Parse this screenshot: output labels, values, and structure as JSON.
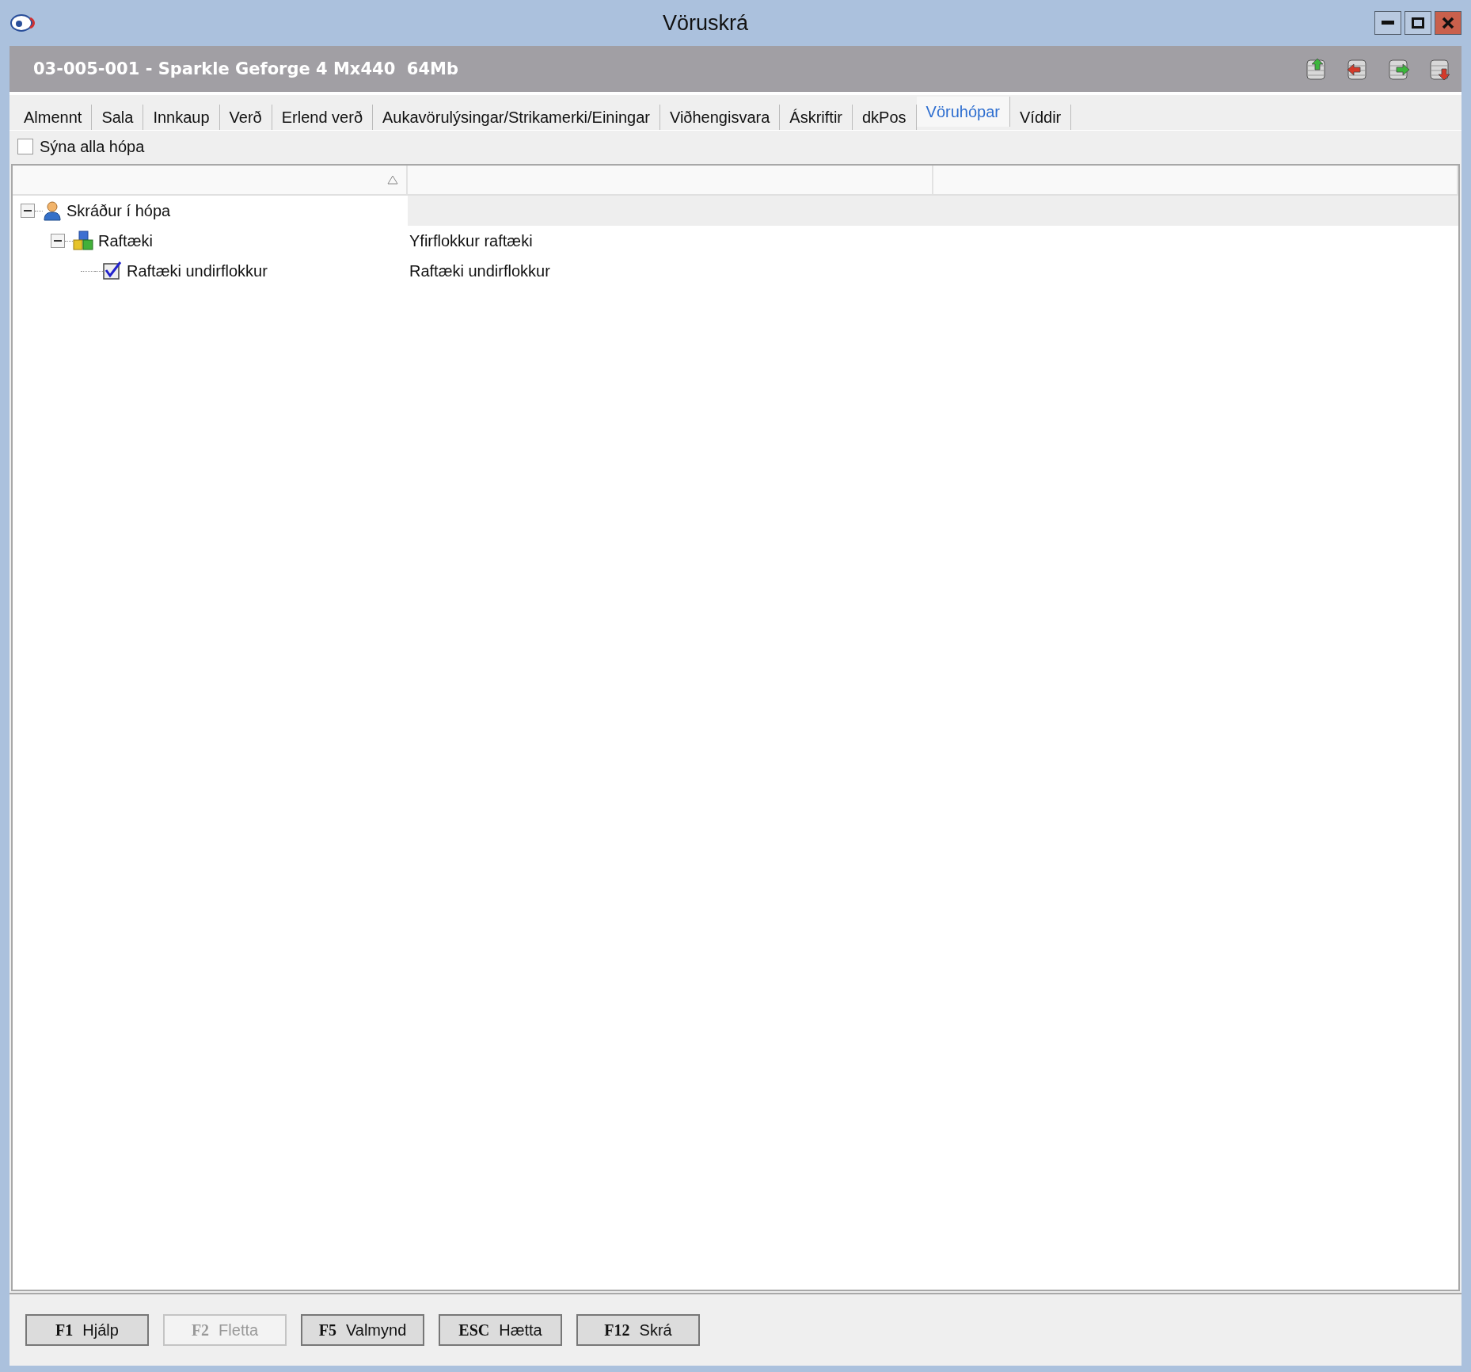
{
  "window": {
    "title": "Vöruskrá"
  },
  "header": {
    "title": "03-005-001 - Sparkle Geforge 4 Mx440  64Mb"
  },
  "tabs": [
    {
      "label": "Almennt",
      "selected": false
    },
    {
      "label": "Sala",
      "selected": false
    },
    {
      "label": "Innkaup",
      "selected": false
    },
    {
      "label": "Verð",
      "selected": false
    },
    {
      "label": "Erlend verð",
      "selected": false
    },
    {
      "label": "Aukavörulýsingar/Strikamerki/Einingar",
      "selected": false
    },
    {
      "label": "Viðhengisvara",
      "selected": false
    },
    {
      "label": "Áskriftir",
      "selected": false
    },
    {
      "label": "dkPos",
      "selected": false
    },
    {
      "label": "Vöruhópar",
      "selected": true
    },
    {
      "label": "Víddir",
      "selected": false
    }
  ],
  "show_all_groups": {
    "label": "Sýna alla hópa",
    "checked": false
  },
  "tree": {
    "rows": [
      {
        "kind": "group",
        "label": "Skráður í hópa",
        "expanded": true,
        "children": [
          {
            "kind": "category",
            "label": "Raftæki",
            "description": "Yfirflokkur raftæki",
            "expanded": true,
            "children": [
              {
                "kind": "leaf",
                "label": "Raftæki undirflokkur",
                "description": "Raftæki undirflokkur",
                "checked": true
              }
            ]
          }
        ]
      }
    ]
  },
  "buttons": [
    {
      "key": "F1",
      "label": "Hjálp",
      "disabled": false
    },
    {
      "key": "F2",
      "label": "Fletta",
      "disabled": true
    },
    {
      "key": "F5",
      "label": "Valmynd",
      "disabled": false
    },
    {
      "key": "ESC",
      "label": "Hætta",
      "disabled": false
    },
    {
      "key": "F12",
      "label": "Skrá",
      "disabled": false
    }
  ]
}
